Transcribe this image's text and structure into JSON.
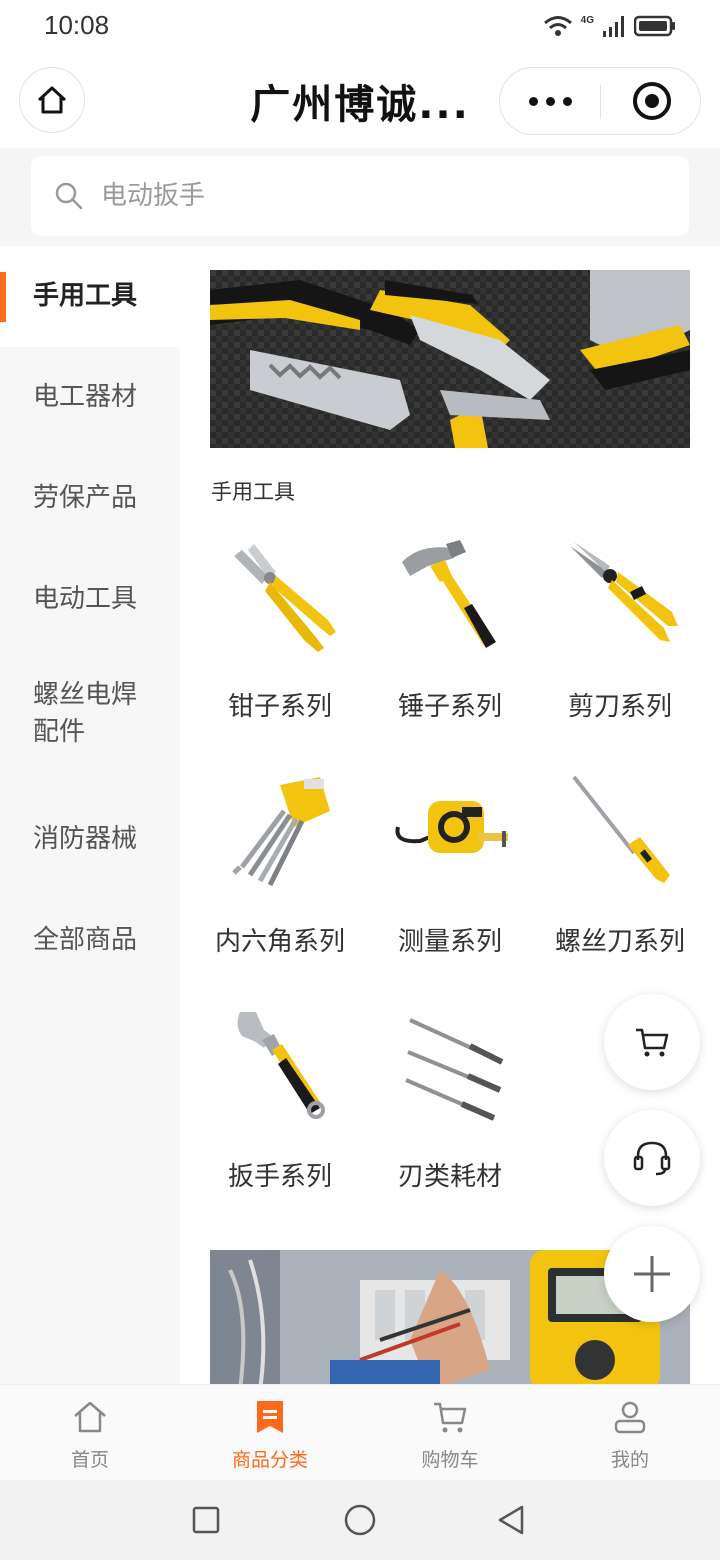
{
  "status_bar": {
    "time": "10:08",
    "network": "4G"
  },
  "nav": {
    "title": "广州博诚..."
  },
  "search": {
    "placeholder": "电动扳手"
  },
  "sidebar": {
    "items": [
      {
        "label": "手用工具",
        "active": true
      },
      {
        "label": "电工器材"
      },
      {
        "label": "劳保产品"
      },
      {
        "label": "电动工具"
      },
      {
        "label": "螺丝电焊配件"
      },
      {
        "label": "消防器械"
      },
      {
        "label": "全部商品"
      }
    ]
  },
  "content": {
    "section_title": "手用工具",
    "categories": [
      {
        "label": "钳子系列",
        "icon": "pliers"
      },
      {
        "label": "锤子系列",
        "icon": "hammer"
      },
      {
        "label": "剪刀系列",
        "icon": "snips"
      },
      {
        "label": "内六角系列",
        "icon": "hex-keys"
      },
      {
        "label": "测量系列",
        "icon": "tape-measure"
      },
      {
        "label": "螺丝刀系列",
        "icon": "screwdriver"
      },
      {
        "label": "扳手系列",
        "icon": "wrench"
      },
      {
        "label": "刃类耗材",
        "icon": "drill-bits"
      }
    ]
  },
  "fabs": [
    "cart",
    "customer-service",
    "plus"
  ],
  "tabs": [
    {
      "label": "首页",
      "icon": "home"
    },
    {
      "label": "商品分类",
      "icon": "category",
      "active": true
    },
    {
      "label": "购物车",
      "icon": "cart"
    },
    {
      "label": "我的",
      "icon": "user"
    }
  ],
  "colors": {
    "accent": "#ff6a1a",
    "tool_yellow": "#f2c40f"
  }
}
